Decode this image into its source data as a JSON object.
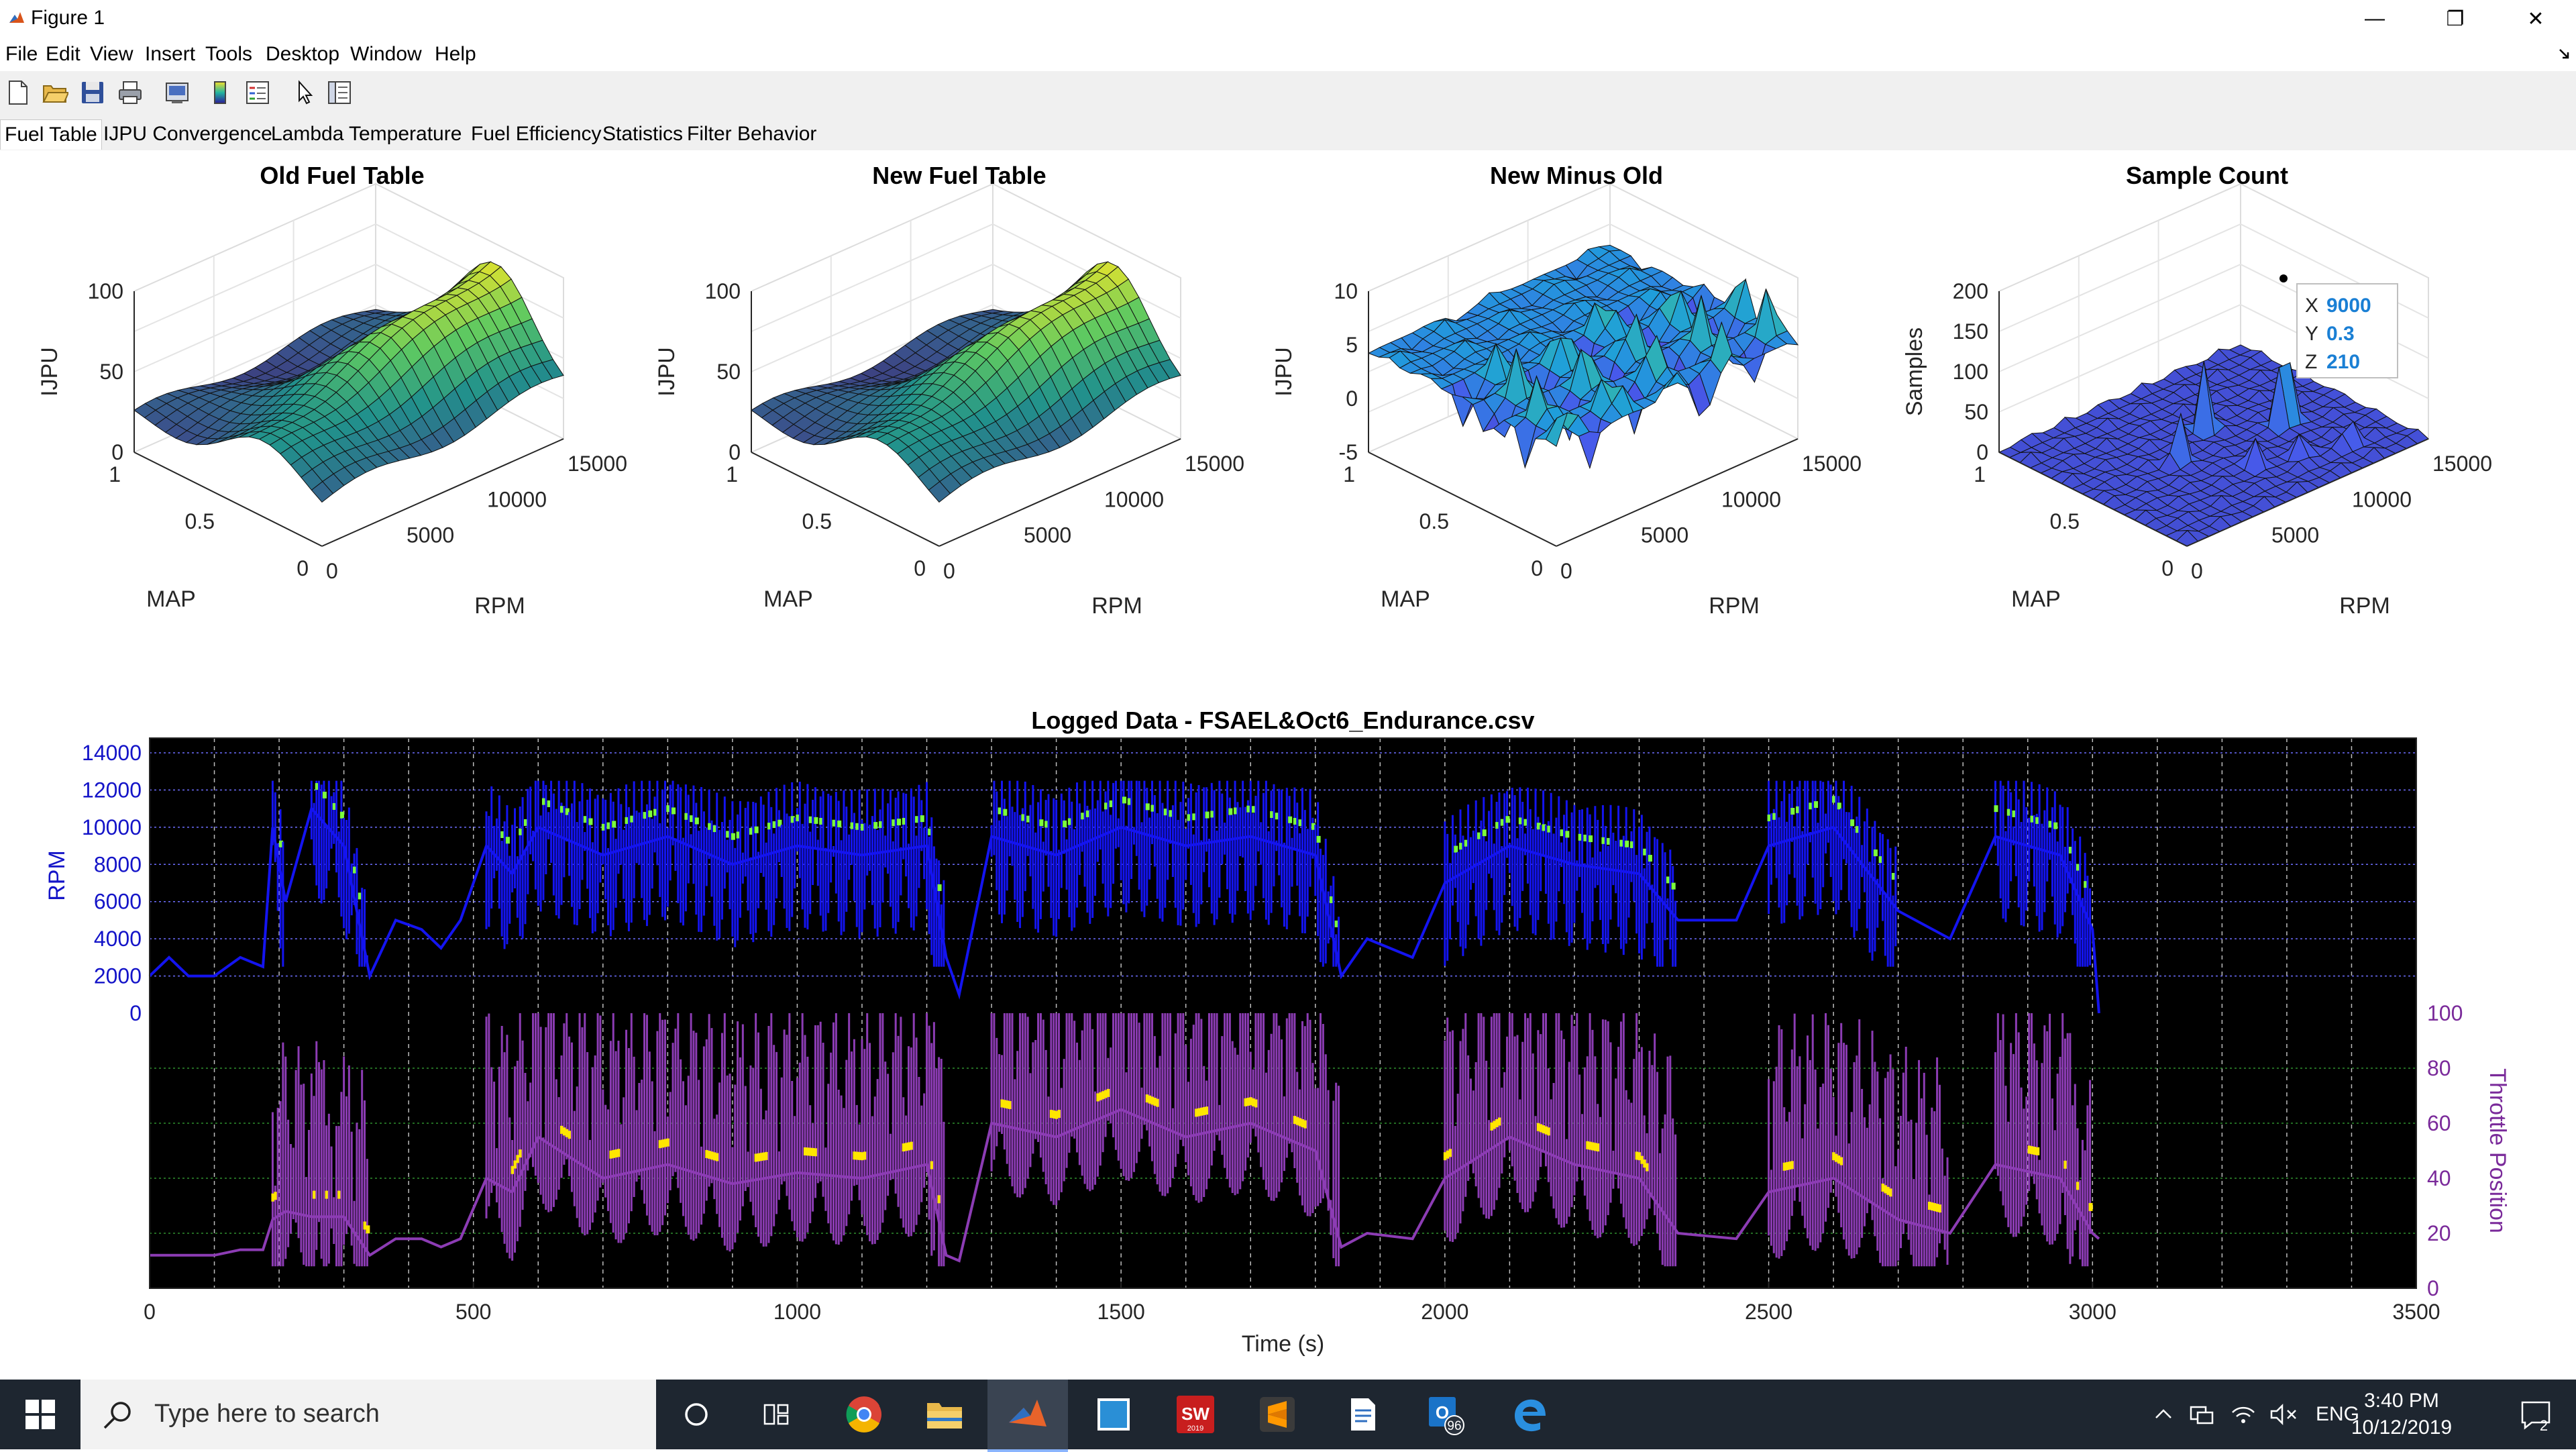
{
  "window": {
    "title": "Figure 1",
    "minimize": "—",
    "restore": "❐",
    "close": "✕"
  },
  "menu": [
    "File",
    "Edit",
    "View",
    "Insert",
    "Tools",
    "Desktop",
    "Window",
    "Help"
  ],
  "toolbar_icons": [
    "new-figure-icon",
    "open-file-icon",
    "save-icon",
    "print-icon",
    "print-preview-icon",
    "colorbar-icon",
    "legend-icon",
    "edit-plot-arrow-icon",
    "property-inspector-icon"
  ],
  "tabs": [
    "Fuel Table",
    "IJPU Convergence",
    "Lambda",
    "Temperature",
    "Fuel Efficiency",
    "Statistics",
    "Filter Behavior"
  ],
  "active_tab": "Fuel Table",
  "surface_plots": [
    {
      "title": "Old Fuel Table",
      "zlabel": "IJPU",
      "xlabel": "MAP",
      "ylabel": "RPM",
      "zticks": [
        "100",
        "50",
        "0"
      ],
      "map_ticks": [
        "1",
        "0.5",
        "0"
      ],
      "rpm_ticks": [
        "0",
        "5000",
        "10000",
        "15000"
      ]
    },
    {
      "title": "New Fuel Table",
      "zlabel": "IJPU",
      "xlabel": "MAP",
      "ylabel": "RPM",
      "zticks": [
        "100",
        "50",
        "0"
      ],
      "map_ticks": [
        "1",
        "0.5",
        "0"
      ],
      "rpm_ticks": [
        "0",
        "5000",
        "10000",
        "15000"
      ]
    },
    {
      "title": "New Minus Old",
      "zlabel": "IJPU",
      "xlabel": "MAP",
      "ylabel": "RPM",
      "zticks": [
        "10",
        "5",
        "0",
        "-5"
      ],
      "map_ticks": [
        "1",
        "0.5",
        "0"
      ],
      "rpm_ticks": [
        "0",
        "5000",
        "10000",
        "15000"
      ]
    },
    {
      "title": "Sample Count",
      "zlabel": "Samples",
      "xlabel": "MAP",
      "ylabel": "RPM",
      "zticks": [
        "200",
        "150",
        "100",
        "50",
        "0"
      ],
      "map_ticks": [
        "1",
        "0.5",
        "0"
      ],
      "rpm_ticks": [
        "0",
        "5000",
        "10000",
        "15000"
      ]
    }
  ],
  "datatip": {
    "x_label": "X",
    "x": "9000",
    "y_label": "Y",
    "y": "0.3",
    "z_label": "Z",
    "z": "210"
  },
  "chart_data": {
    "type": "line",
    "title": "Logged Data - FSAEL&Oct6_Endurance.csv",
    "xlabel": "Time (s)",
    "x_ticks": [
      "0",
      "500",
      "1000",
      "1500",
      "2000",
      "2500",
      "3000",
      "3500"
    ],
    "xlim": [
      0,
      3500
    ],
    "ylabel_left": "RPM",
    "y_ticks_left": [
      "14000",
      "12000",
      "10000",
      "8000",
      "6000",
      "4000",
      "2000",
      "0"
    ],
    "ylim_left": [
      0,
      14000
    ],
    "ylabel_right": "Throttle Position",
    "y_ticks_right": [
      "100",
      "80",
      "60",
      "40",
      "20",
      "0"
    ],
    "ylim_right": [
      0,
      100
    ],
    "background": "#000000",
    "grid": true,
    "series": [
      {
        "color": "#1414f0",
        "marker_color": "#7cff3c",
        "x": [
          0,
          30,
          60,
          100,
          140,
          175,
          190,
          210,
          250,
          300,
          340,
          380,
          420,
          450,
          480,
          520,
          560,
          600,
          700,
          800,
          900,
          1000,
          1100,
          1200,
          1230,
          1250,
          1300,
          1400,
          1500,
          1600,
          1700,
          1800,
          1840,
          1880,
          1950,
          2000,
          2100,
          2200,
          2300,
          2360,
          2450,
          2500,
          2600,
          2700,
          2780,
          2850,
          2950,
          3000,
          3010
        ],
        "y": [
          2000,
          3000,
          2000,
          2000,
          3000,
          2500,
          10000,
          6000,
          11000,
          9000,
          2000,
          5000,
          4500,
          3500,
          5000,
          9000,
          7500,
          10000,
          8500,
          9500,
          8000,
          9000,
          8500,
          9000,
          3000,
          1000,
          9500,
          8500,
          10000,
          9000,
          9500,
          8500,
          2000,
          4000,
          3000,
          7000,
          9000,
          8000,
          7500,
          5000,
          5000,
          9000,
          10000,
          5500,
          4000,
          9500,
          8500,
          4500,
          0
        ]
      },
      {
        "color": "#8c3cb4",
        "marker_color": "#ffe600",
        "x": [
          0,
          30,
          60,
          100,
          140,
          175,
          190,
          210,
          250,
          300,
          340,
          380,
          420,
          450,
          480,
          520,
          560,
          600,
          700,
          800,
          900,
          1000,
          1100,
          1200,
          1230,
          1250,
          1300,
          1400,
          1500,
          1600,
          1700,
          1800,
          1840,
          1880,
          1950,
          2000,
          2100,
          2200,
          2300,
          2360,
          2450,
          2500,
          2600,
          2700,
          2780,
          2850,
          2950,
          3000,
          3010
        ],
        "y": [
          12,
          12,
          12,
          12,
          14,
          14,
          25,
          28,
          26,
          26,
          12,
          18,
          18,
          15,
          18,
          40,
          35,
          55,
          40,
          45,
          38,
          42,
          40,
          45,
          12,
          10,
          60,
          55,
          65,
          55,
          60,
          50,
          15,
          20,
          18,
          40,
          55,
          45,
          40,
          20,
          18,
          35,
          40,
          25,
          20,
          45,
          40,
          20,
          18
        ]
      }
    ]
  },
  "taskbar": {
    "search_placeholder": "Type here to search",
    "apps": [
      "task-view-icon",
      "chrome-icon",
      "file-explorer-icon",
      "matlab-icon",
      "app-window-icon",
      "solidworks-icon",
      "sublime-text-icon",
      "document-icon",
      "outlook-icon",
      "edge-icon"
    ],
    "outlook_badge": "96",
    "solidworks_year": "2019",
    "language": "ENG",
    "time": "3:40 PM",
    "date": "10/12/2019",
    "notifications": "2"
  }
}
